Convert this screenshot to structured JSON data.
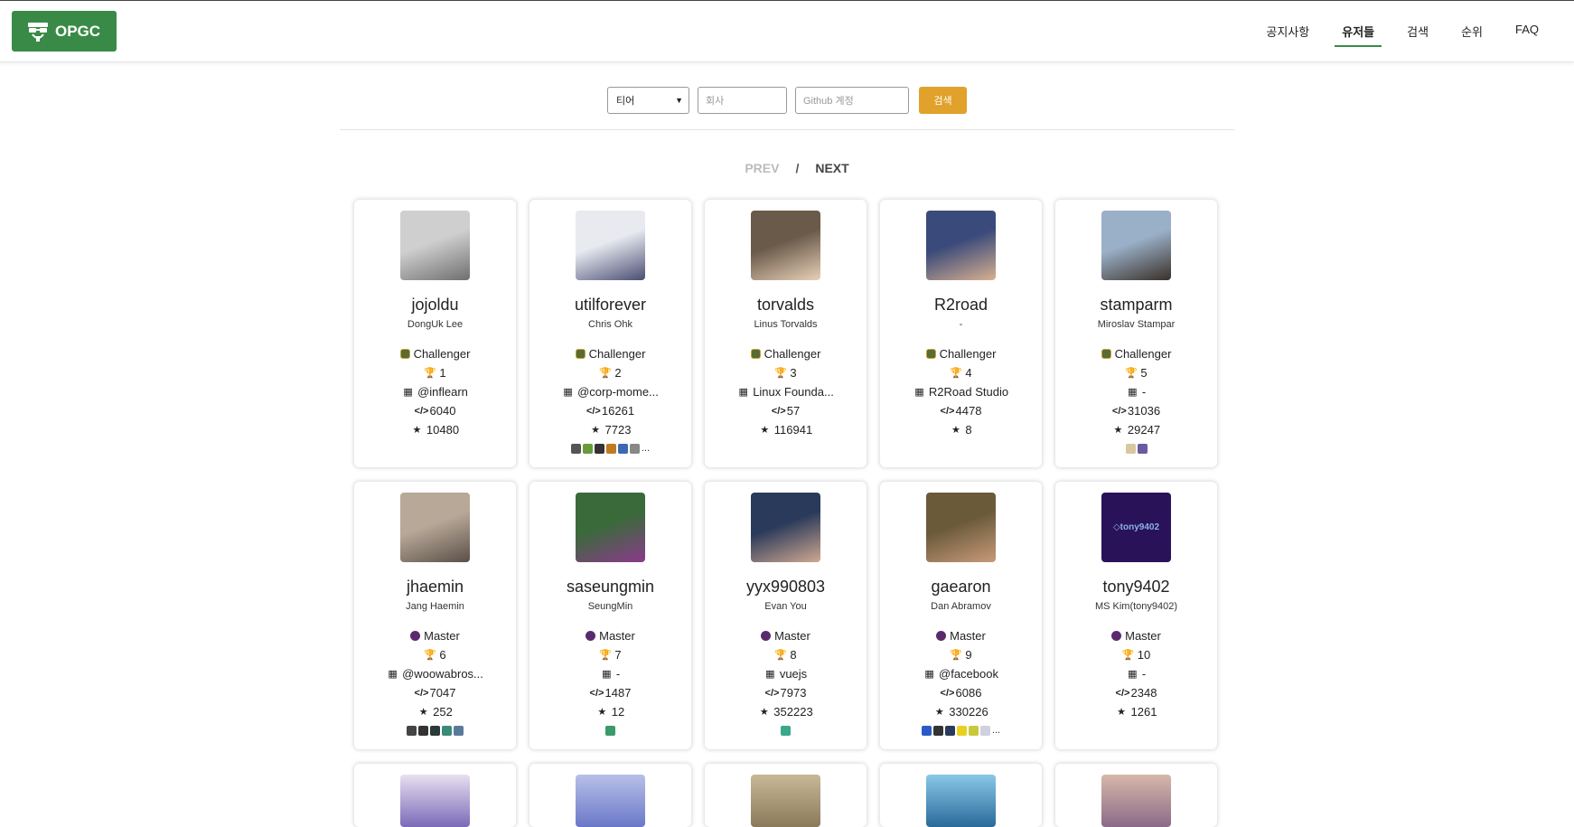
{
  "header": {
    "logo_text": "OPGC",
    "nav": [
      {
        "label": "공지사항",
        "active": false
      },
      {
        "label": "유저들",
        "active": true
      },
      {
        "label": "검색",
        "active": false
      },
      {
        "label": "순위",
        "active": false
      },
      {
        "label": "FAQ",
        "active": false
      }
    ]
  },
  "search": {
    "tier_selected": "티어",
    "company_placeholder": "회사",
    "github_placeholder": "Github 계정",
    "button_label": "검색"
  },
  "pager": {
    "prev": "PREV",
    "slash": "/",
    "next": "NEXT"
  },
  "users": [
    {
      "username": "jojoldu",
      "name": "DongUk Lee",
      "tier": "Challenger",
      "tier_key": "challenger",
      "rank": "1",
      "company": "@inflearn",
      "code": "6040",
      "stars": "10480",
      "avatar_colors": [
        "#cfcfcf",
        "#6f6f6f"
      ],
      "badges": [],
      "more": ""
    },
    {
      "username": "utilforever",
      "name": "Chris Ohk",
      "tier": "Challenger",
      "tier_key": "challenger",
      "rank": "2",
      "company": "@corp-mome...",
      "code": "16261",
      "stars": "7723",
      "avatar_colors": [
        "#e8eaf0",
        "#4a4e72"
      ],
      "badges": [
        "#555",
        "#6a9a3a",
        "#333",
        "#c07a20",
        "#3a6ab0",
        "#888"
      ],
      "more": "..."
    },
    {
      "username": "torvalds",
      "name": "Linus Torvalds",
      "tier": "Challenger",
      "tier_key": "challenger",
      "rank": "3",
      "company": "Linux Founda...",
      "code": "57",
      "stars": "116941",
      "avatar_colors": [
        "#6a5a4a",
        "#e8d0b8"
      ],
      "badges": [],
      "more": ""
    },
    {
      "username": "R2road",
      "name": "-",
      "tier": "Challenger",
      "tier_key": "challenger",
      "rank": "4",
      "company": "R2Road Studio",
      "code": "4478",
      "stars": "8",
      "avatar_colors": [
        "#3a4a7a",
        "#d8b090"
      ],
      "badges": [],
      "more": ""
    },
    {
      "username": "stamparm",
      "name": "Miroslav Stampar",
      "tier": "Challenger",
      "tier_key": "challenger",
      "rank": "5",
      "company": "-",
      "code": "31036",
      "stars": "29247",
      "avatar_colors": [
        "#9ab0c8",
        "#3a3028"
      ],
      "badges": [
        "#d8c8a0",
        "#6a5aa0"
      ],
      "more": ""
    },
    {
      "username": "jhaemin",
      "name": "Jang Haemin",
      "tier": "Master",
      "tier_key": "master",
      "rank": "6",
      "company": "@woowabros...",
      "code": "7047",
      "stars": "252",
      "avatar_colors": [
        "#b8a898",
        "#5a5048"
      ],
      "badges": [
        "#444",
        "#333",
        "#2a3a3a",
        "#3a8a7a",
        "#5a7a9a"
      ],
      "more": ""
    },
    {
      "username": "saseungmin",
      "name": "SeungMin",
      "tier": "Master",
      "tier_key": "master",
      "rank": "7",
      "company": "-",
      "code": "1487",
      "stars": "12",
      "avatar_colors": [
        "#3a6a3a",
        "#8a3a8a"
      ],
      "badges": [
        "#3a9a6a"
      ],
      "more": ""
    },
    {
      "username": "yyx990803",
      "name": "Evan You",
      "tier": "Master",
      "tier_key": "master",
      "rank": "8",
      "company": "vuejs",
      "code": "7973",
      "stars": "352223",
      "avatar_colors": [
        "#2a3a5a",
        "#d0a890"
      ],
      "badges": [
        "#3aa88a"
      ],
      "more": ""
    },
    {
      "username": "gaearon",
      "name": "Dan Abramov",
      "tier": "Master",
      "tier_key": "master",
      "rank": "9",
      "company": "@facebook",
      "code": "6086",
      "stars": "330226",
      "avatar_colors": [
        "#6a5a3a",
        "#c89a7a"
      ],
      "badges": [
        "#2a5ac8",
        "#333",
        "#2a3a5a",
        "#e8d020",
        "#c8c83a",
        "#d0d0e0"
      ],
      "more": "..."
    },
    {
      "username": "tony9402",
      "name": "MS Kim(tony9402)",
      "tier": "Master",
      "tier_key": "master",
      "rank": "10",
      "company": "-",
      "code": "2348",
      "stars": "1261",
      "avatar_colors": [
        "#2a1258",
        "#3a2a7a"
      ],
      "avatar_text": "tony9402",
      "badges": [],
      "more": ""
    }
  ],
  "partial_row_avatars": [
    [
      "#7a6ab8",
      "#e8e0f0"
    ],
    [
      "#6a78c8",
      "#b8c0e8"
    ],
    [
      "#8a7a5a",
      "#c8b898"
    ],
    [
      "#2a6a9a",
      "#8ac8e8"
    ],
    [
      "#8a6a8a",
      "#d8b8a8"
    ]
  ]
}
